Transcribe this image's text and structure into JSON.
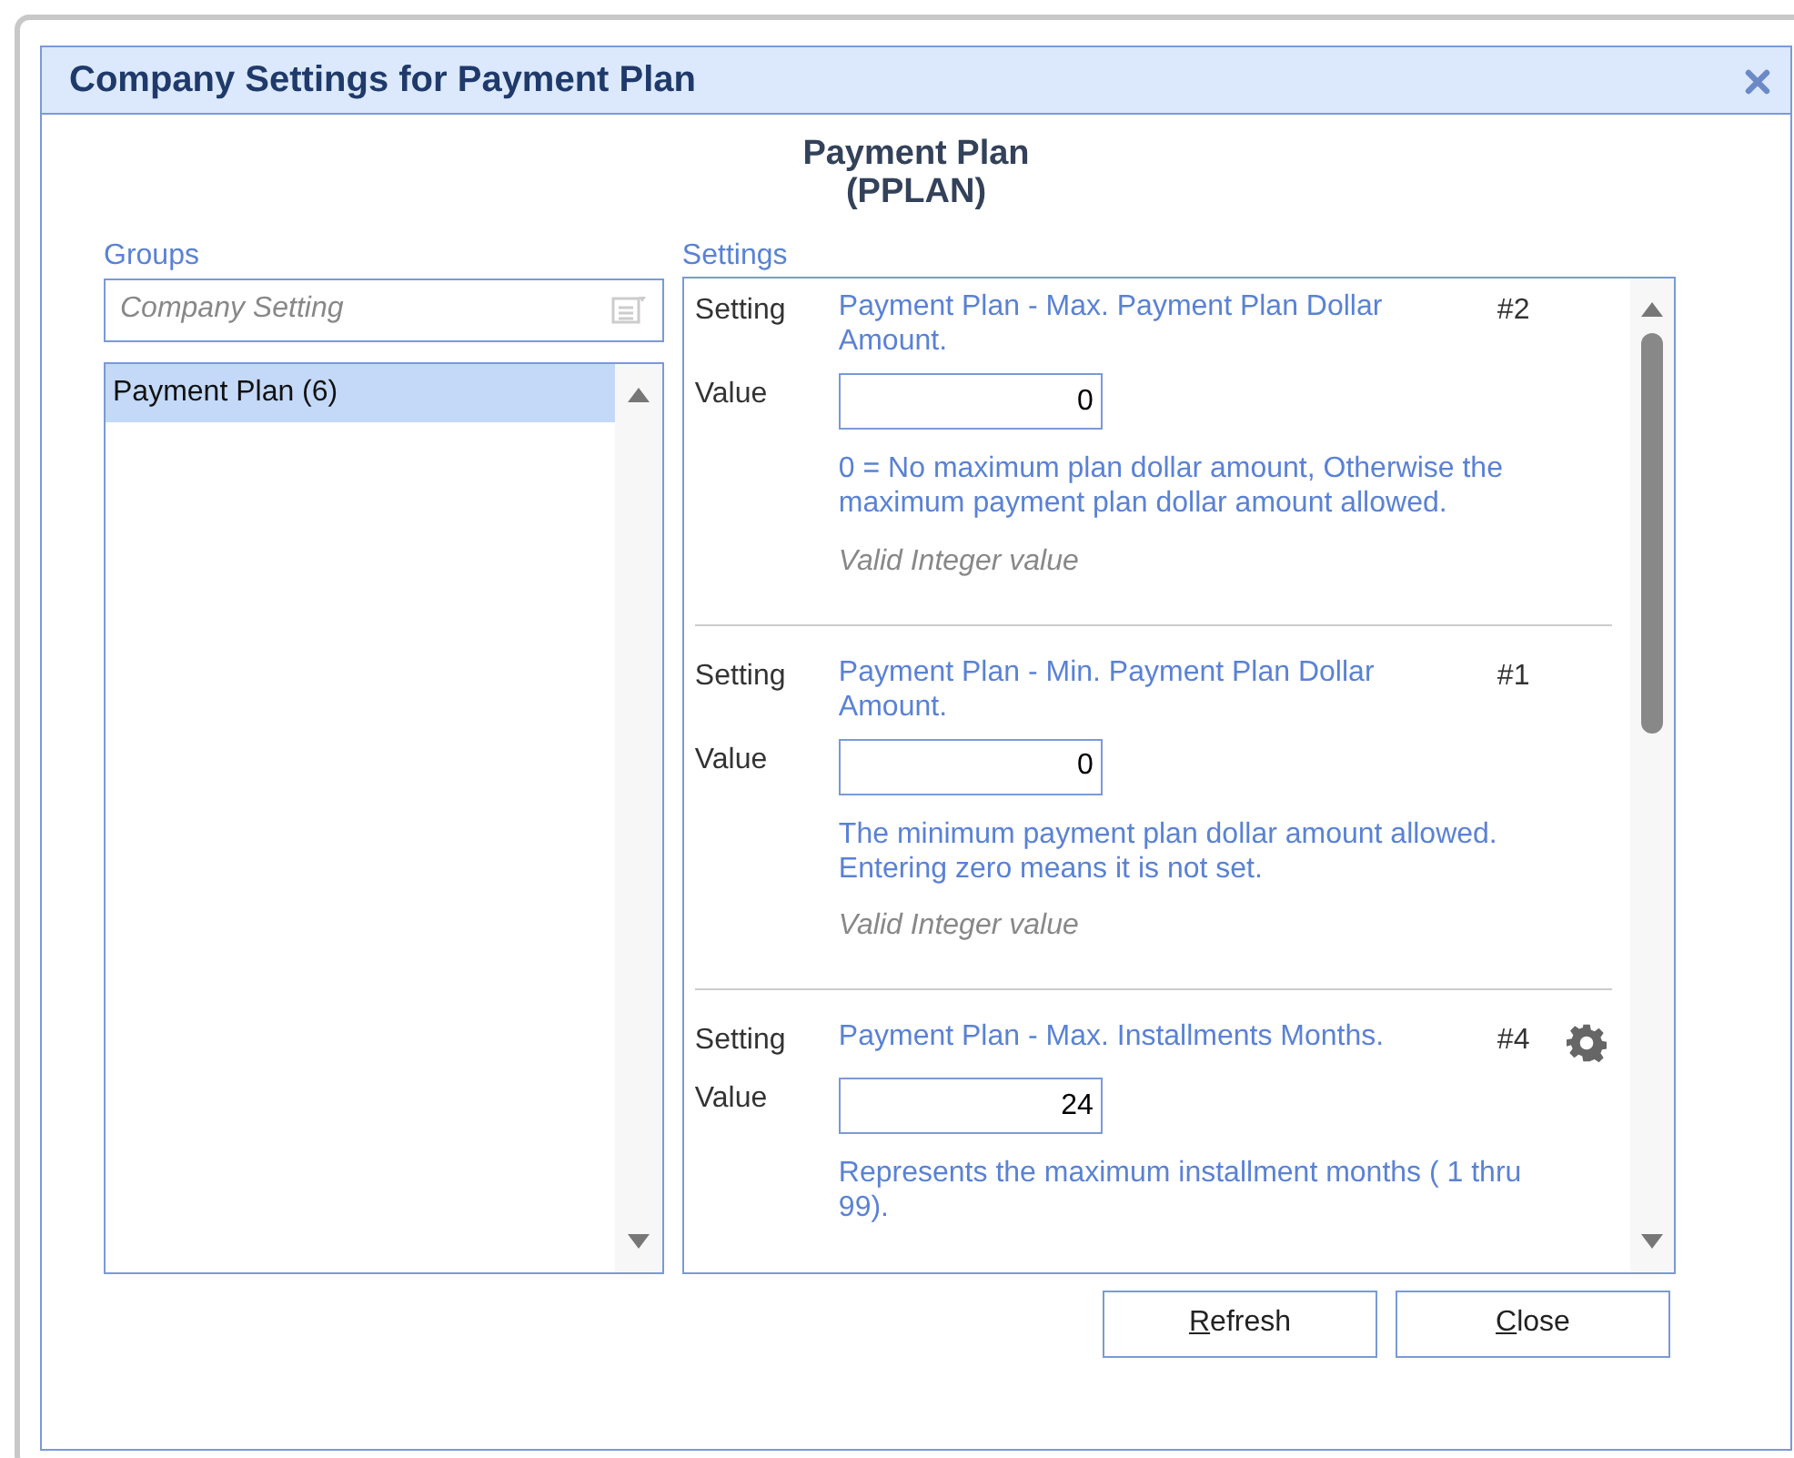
{
  "window": {
    "title": "Company Settings for Payment Plan"
  },
  "header": {
    "line_1": "Payment Plan",
    "line_2": "(PPLAN)"
  },
  "groups": {
    "label": "Groups",
    "search": {
      "placeholder": "Company Setting"
    },
    "items": [
      {
        "label": "Payment Plan (6)",
        "selected": true
      }
    ]
  },
  "settings": {
    "label": "Settings",
    "items": [
      {
        "setting_label": "Setting",
        "name": "Payment Plan - Max. Payment Plan Dollar Amount.",
        "number": "#2",
        "value_label": "Value",
        "value": "0",
        "description": "0 = No maximum plan dollar amount, Otherwise the maximum payment plan dollar amount allowed.",
        "validation": "Valid Integer value",
        "has_gear": false
      },
      {
        "setting_label": "Setting",
        "name": "Payment Plan - Min. Payment Plan Dollar Amount.",
        "number": "#1",
        "value_label": "Value",
        "value": "0",
        "description": "The minimum payment plan dollar amount allowed. Entering zero means it is not set.",
        "validation": "Valid Integer value",
        "has_gear": false
      },
      {
        "setting_label": "Setting",
        "name": "Payment Plan - Max. Installments Months.",
        "number": "#4",
        "value_label": "Value",
        "value": "24",
        "description": "Represents the maximum installment months ( 1 thru 99).",
        "has_gear": true
      }
    ]
  },
  "buttons": [
    {
      "label": "Refresh",
      "mnemonic_underlined": true
    },
    {
      "label": "Close",
      "mnemonic_underlined": true
    }
  ]
}
